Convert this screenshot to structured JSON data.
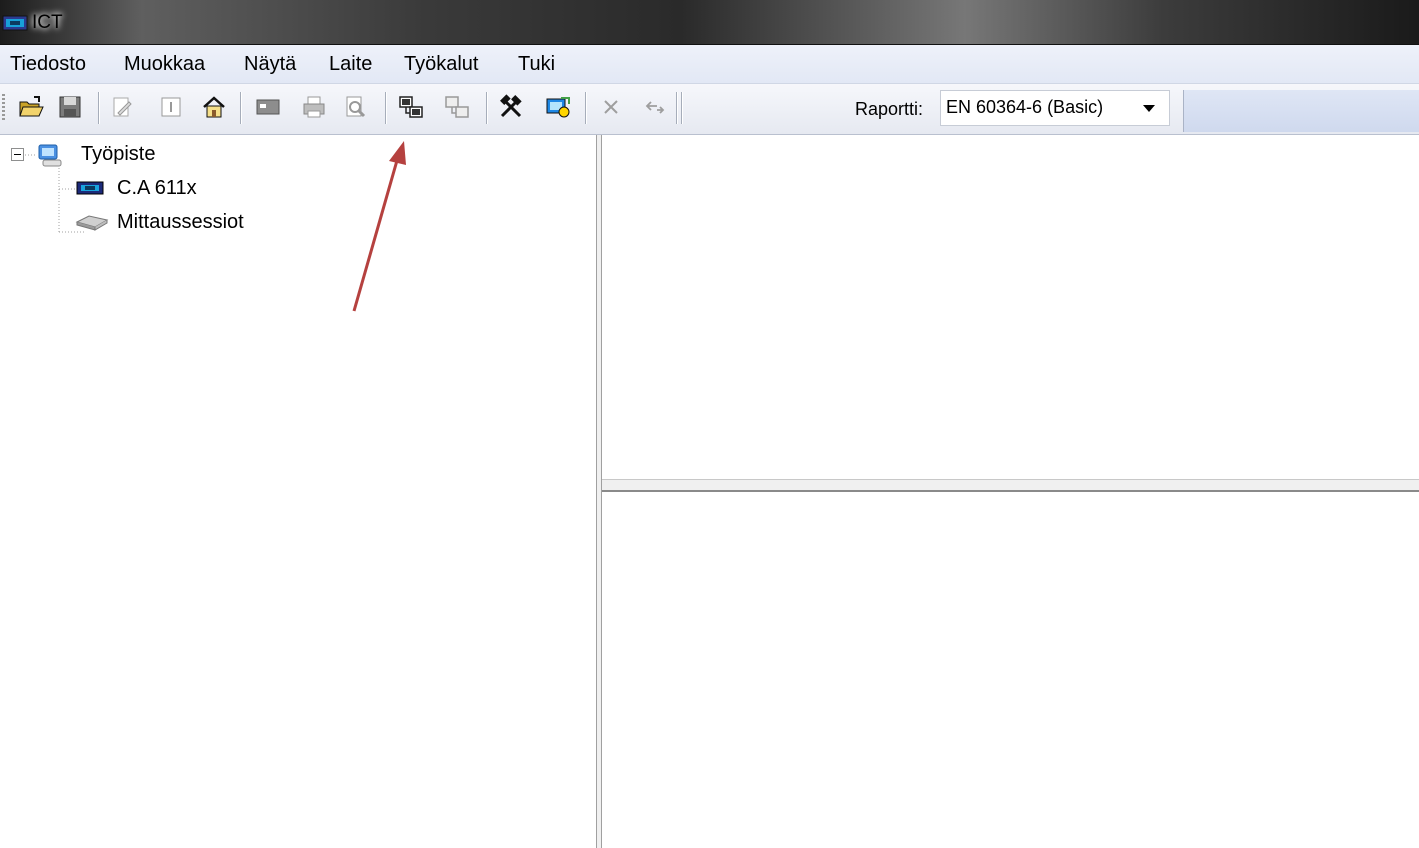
{
  "window": {
    "title": "ICT"
  },
  "menu": [
    "Tiedosto",
    "Muokkaa",
    "Näytä",
    "Laite",
    "Työkalut",
    "Tuki"
  ],
  "toolbar": {
    "report_label": "Raportti:",
    "report_value": "EN 60364-6 (Basic)",
    "buttons": [
      "open-folder",
      "save",
      "edit",
      "info",
      "home",
      "connect-port",
      "print",
      "print-preview",
      "connect-device",
      "disconnect-device",
      "tools",
      "monitor-settings",
      "delete",
      "undo"
    ]
  },
  "tree": {
    "root": "Työpiste",
    "children": [
      "C.A 611x",
      "Mittaussessiot"
    ]
  },
  "annotation": {
    "arrow_color": "#b5413f"
  }
}
